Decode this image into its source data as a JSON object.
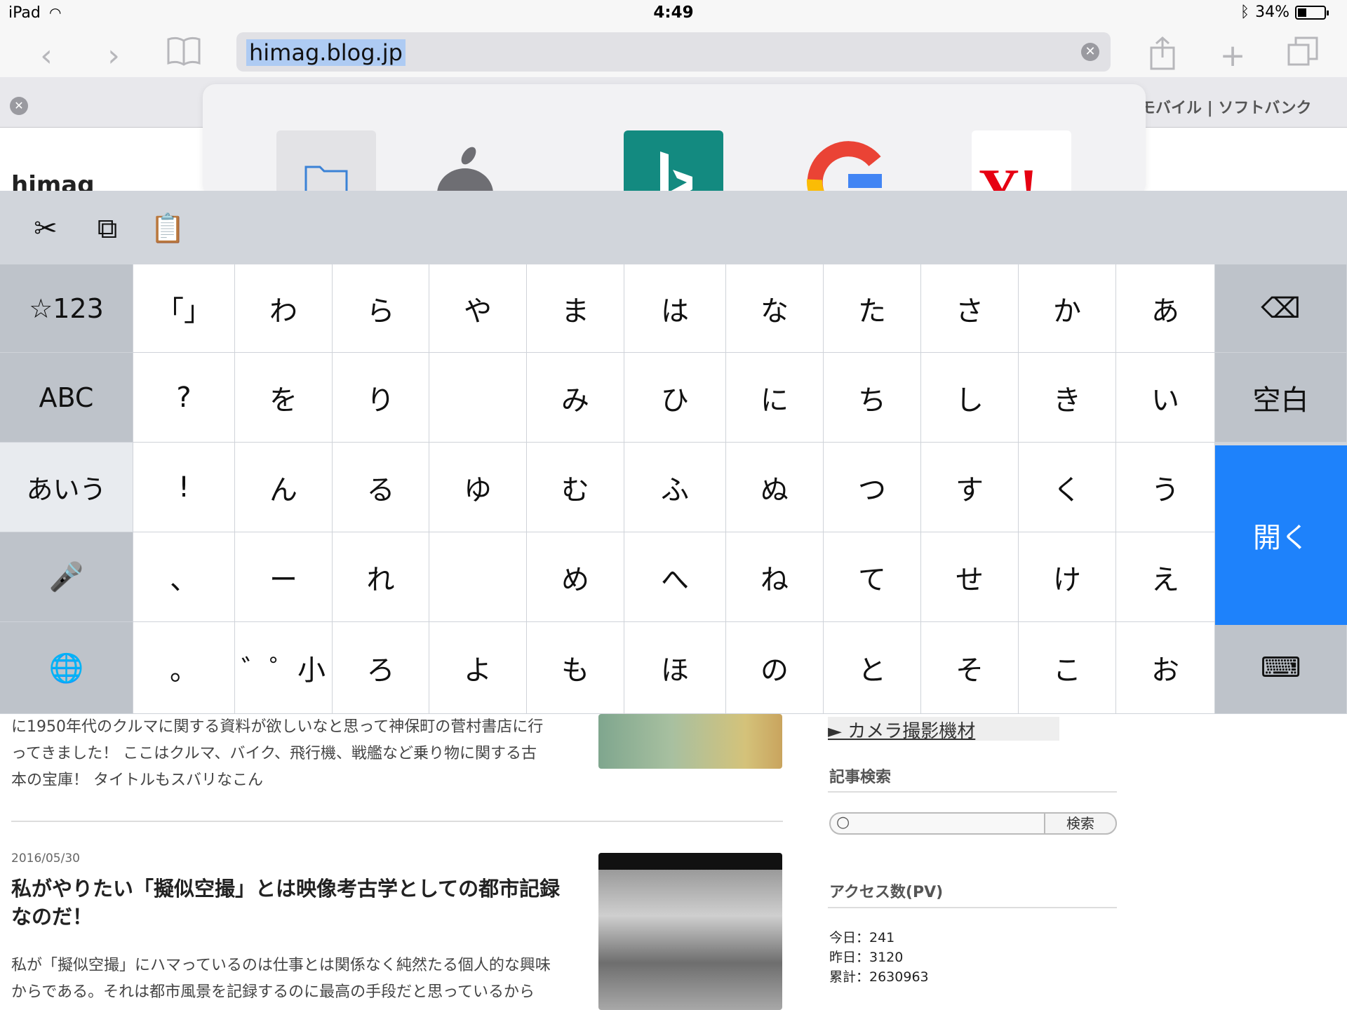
{
  "status": {
    "device": "iPad",
    "time": "4:49",
    "battery": "34%",
    "battery_fraction": 0.34
  },
  "browser": {
    "url": "himag.blog.jp",
    "tab_title": "モバイル | ソフトバンク",
    "site_title": "himag"
  },
  "keyboard": {
    "rows": [
      [
        "☆123",
        "「」",
        "わ",
        "ら",
        "や",
        "ま",
        "は",
        "な",
        "た",
        "さ",
        "か",
        "あ",
        "⌫"
      ],
      [
        "ABC",
        "?",
        "を",
        "り",
        "",
        "み",
        "ひ",
        "に",
        "ち",
        "し",
        "き",
        "い",
        "空白"
      ],
      [
        "あいう",
        "!",
        "ん",
        "る",
        "ゆ",
        "む",
        "ふ",
        "ぬ",
        "つ",
        "す",
        "く",
        "う",
        ""
      ],
      [
        "🎤",
        "、",
        "ー",
        "れ",
        "",
        "め",
        "へ",
        "ね",
        "て",
        "せ",
        "け",
        "え",
        ""
      ],
      [
        "🌐",
        "。",
        "゛゜小",
        "ろ",
        "よ",
        "も",
        "ほ",
        "の",
        "と",
        "そ",
        "こ",
        "お",
        "⌨"
      ]
    ],
    "open_label": "開く"
  },
  "article": {
    "excerpt1_lines": [
      "に1950年代のクルマに関する資料が欲しいなと思って神保町の菅村書店に行",
      "ってきました！ ここはクルマ、バイク、飛行機、戦艦など乗り物に関する古",
      "本の宝庫！ タイトルもスバリなこん"
    ],
    "date2": "2016/05/30",
    "title2_lines": [
      "私がやりたい「擬似空撮」とは映像考古学としての都市記録",
      "なのだ！"
    ],
    "excerpt2_lines": [
      "私が「擬似空撮」にハマっているのは仕事とは関係なく純然たる個人的な興味",
      "からである。それは都市風景を記録するのに最高の手段だと思っているから"
    ]
  },
  "sidebar": {
    "link": "► カメラ撮影機材",
    "search_heading": "記事検索",
    "search_button": "検索",
    "pv_heading": "アクセス数(PV)",
    "pv_today": "今日：241",
    "pv_yesterday": "昨日：3120",
    "pv_total": "累計：2630963"
  }
}
